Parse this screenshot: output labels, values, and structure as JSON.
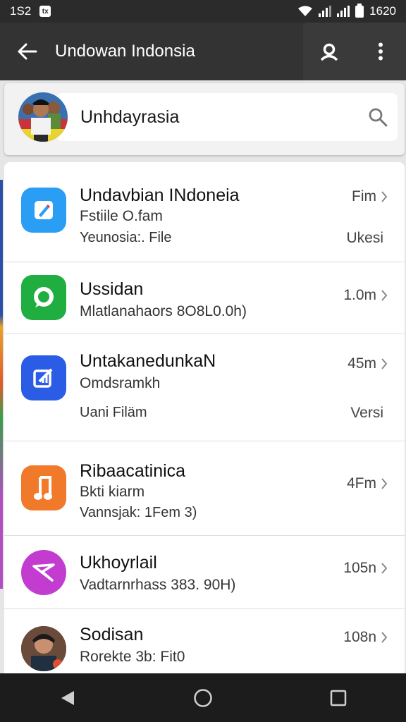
{
  "status_bar": {
    "time": "1S2",
    "notification": "tx",
    "clock_right": "1620"
  },
  "app_bar": {
    "title": "Undowan Indonsia"
  },
  "search": {
    "query": "Unhdayrasia"
  },
  "apps": [
    {
      "name": "Undavbian INdoneia",
      "subtitle": "Fstiile O.fam",
      "detail": "Yeunosia:. File",
      "size": "Fim",
      "version": "Ukesi",
      "color": "#2a9df4"
    },
    {
      "name": "Ussidan",
      "subtitle": "Mlatlanahaors 8O8L0.0h)",
      "size": "1.0m",
      "color": "#1fae3f"
    },
    {
      "name": "UntakanedunkaN",
      "subtitle": "Omdsramkh",
      "detail": "Uani Filäm",
      "size": "45m",
      "version": "Versi",
      "color": "#2b5ce6"
    },
    {
      "name": "Ribaacatinica",
      "subtitle": "Bkti kiarm",
      "detail": "Vannsjak: 1Fem 3)",
      "size": "4Fm",
      "color": "#f07a2a"
    },
    {
      "name": "Ukhoyrlail",
      "subtitle": "Vadtarnrhass 383. 90H)",
      "size": "105n",
      "color": "#c33cd0"
    },
    {
      "name": "Sodisan",
      "subtitle": "Rorekte 3b: Fit0",
      "size": "108n"
    }
  ]
}
